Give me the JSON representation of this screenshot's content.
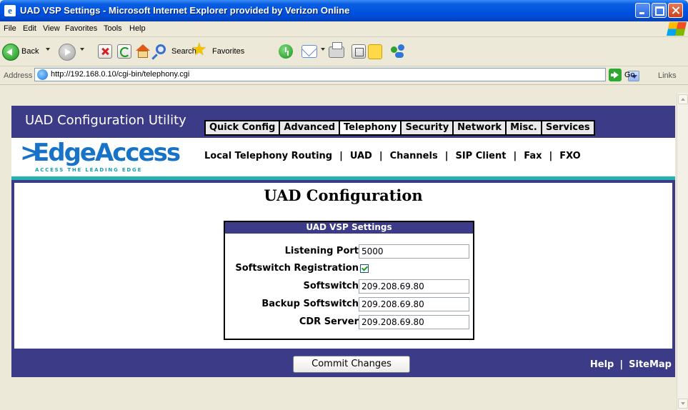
{
  "window": {
    "title": "UAD VSP Settings - Microsoft Internet Explorer provided by Verizon Online",
    "app_icon": "e"
  },
  "menubar": [
    "File",
    "Edit",
    "View",
    "Favorites",
    "Tools",
    "Help"
  ],
  "toolbar": {
    "back_label": "Back",
    "search_label": "Search",
    "favorites_label": "Favorites"
  },
  "addressbar": {
    "label": "Address",
    "url": "http://192.168.0.10/cgi-bin/telephony.cgi",
    "go_label": "Go",
    "links_label": "Links"
  },
  "app": {
    "title": "UAD Configuration Utility",
    "tabs": [
      "Quick Config",
      "Advanced",
      "Telephony",
      "Security",
      "Network",
      "Misc.",
      "Services"
    ],
    "active_tab": "Telephony",
    "logo": {
      "chevron": ">",
      "name": "EdgeAccess",
      "tagline": "ACCESS THE LEADING EDGE"
    },
    "subnav": [
      "Local Telephony Routing",
      "UAD",
      "Channels",
      "SIP Client",
      "Fax",
      "FXO"
    ],
    "subnav_separator": "|"
  },
  "page": {
    "heading": "UAD Configuration",
    "form": {
      "title": "UAD VSP Settings",
      "listening_port": {
        "label": "Listening Port",
        "value": "5000"
      },
      "softswitch_registration": {
        "label": "Softswitch Registration",
        "checked": true
      },
      "softswitch": {
        "label": "Softswitch",
        "value": "209.208.69.80"
      },
      "backup_softswitch": {
        "label": "Backup Softswitch",
        "value": "209.208.69.80"
      },
      "cdr_server": {
        "label": "CDR Server",
        "value": "209.208.69.80"
      }
    },
    "commit_button": "Commit Changes",
    "footer_links": [
      "Help",
      "SiteMap"
    ],
    "footer_separator": "|"
  },
  "colors": {
    "header_bg": "#3B3B87",
    "accent_teal": "#22B4B4",
    "logo_blue": "#1673C8"
  }
}
